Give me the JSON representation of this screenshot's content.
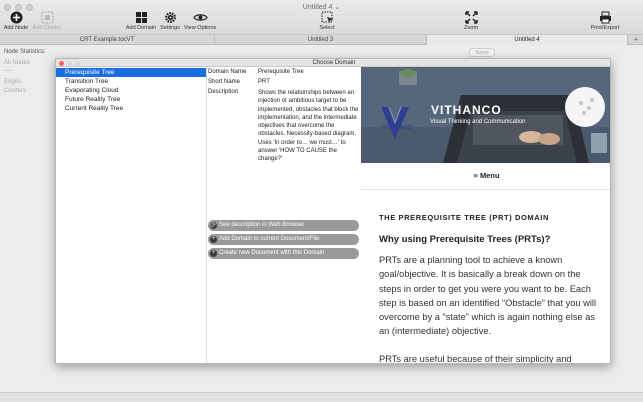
{
  "window": {
    "title": "Untitled 4 ⌄"
  },
  "toolbar": {
    "add_node": "Add Node",
    "add_cluster": "Add Cluster",
    "add_domain": "Add Domain",
    "settings": "Settings",
    "view_options": "View Options",
    "select": "Select",
    "zoom": "Zoom",
    "print_export": "Print/Export"
  },
  "tabs": [
    {
      "label": "CRT Example.tocVT"
    },
    {
      "label": "Untitled 3"
    },
    {
      "label": "Untitled 4"
    }
  ],
  "sidebar": {
    "heading": "Node Statistics:",
    "items": [
      "All Nodes",
      "----",
      "Edges",
      "Clusters"
    ]
  },
  "background": {
    "none_button": "None"
  },
  "dialog": {
    "title": "Choose Domain",
    "domains": [
      "Prerequisite Tree",
      "Transition Tree",
      "Evaporating Cloud",
      "Future Reality Tree",
      "Current Reality Tree"
    ],
    "selected_index": 0,
    "fields": {
      "domain_name_label": "Domain Name",
      "domain_name": "Prerequisite Tree",
      "short_name_label": "Short Name",
      "short_name": "PRT",
      "description_label": "Description",
      "description": "Shows the relationships between an injection or ambitious target to be implemented, obstacles that block the implementation, and the intermediate objectives that overcome the obstacles. Necessity-based diagram. Uses 'In order to… we must…' to answer 'HOW TO CAUSE the change?'"
    },
    "actions": {
      "web": "See description in Web Browser",
      "add_to_doc": "Add Domain to current Document/File",
      "new_doc": "Create new Document with this Domain"
    }
  },
  "webpage": {
    "brand": "VITHANCO",
    "tagline": "Visual Thinking and Communication",
    "logo_text": "VITHANCO",
    "menu": "Menu",
    "heading": "THE PREREQUISITE TREE (PRT) DOMAIN",
    "subheading": "Why using Prerequisite Trees (PRTs)?",
    "para1": "PRTs are a planning tool to achieve a known goal/objective. It is basically a break down on the steps in order to get you were you want to be. Each step is based on an identified “Obstacle” that you will overcome by a “state” which is again nothing else as an (intermediate) objective.",
    "para2": "PRTs are useful because of their simplicity and"
  },
  "colors": {
    "selection": "#1a6fe0",
    "pill": "#9a9a9a"
  }
}
